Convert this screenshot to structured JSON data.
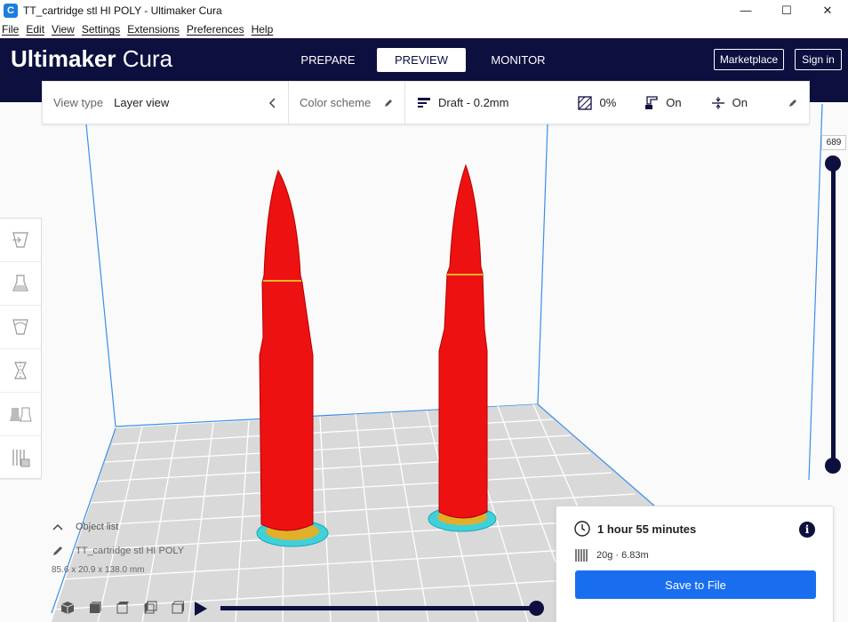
{
  "window": {
    "title": "TT_cartridge stl HI POLY - Ultimaker Cura",
    "app_icon": "C",
    "minimize": "—",
    "maximize": "☐",
    "close": "✕"
  },
  "menu": [
    "File",
    "Edit",
    "View",
    "Settings",
    "Extensions",
    "Preferences",
    "Help"
  ],
  "header": {
    "logo_bold": "Ultimaker",
    "logo_light": "Cura",
    "tabs": [
      {
        "label": "PREPARE",
        "active": false
      },
      {
        "label": "PREVIEW",
        "active": true
      },
      {
        "label": "MONITOR",
        "active": false
      }
    ],
    "marketplace_label": "Marketplace",
    "signin_label": "Sign in",
    "colors": {
      "header_bg": "#0d0f3f",
      "accent": "#196ef0"
    }
  },
  "toolbar": {
    "view_type_label": "View type",
    "view_type_value": "Layer view",
    "color_scheme_label": "Color scheme",
    "profile": "Draft - 0.2mm",
    "infill": "0%",
    "support": "On",
    "adhesion": "On"
  },
  "left_tools": [
    "move-tool-icon",
    "scale-tool-icon",
    "rotate-tool-icon",
    "mirror-tool-icon",
    "per-model-settings-icon",
    "support-blocker-icon"
  ],
  "layer_slider": {
    "current_layer": "689"
  },
  "object_list": {
    "title": "Object list",
    "object_name": "TT_cartridge stl HI POLY",
    "dimensions": "85.6 x 20.9 x 138.0 mm"
  },
  "print_info": {
    "time": "1 hour 55 minutes",
    "material": "20g · 6.83m",
    "save_label": "Save to File",
    "info_glyph": "i"
  },
  "playback": {
    "progress": 1.0
  }
}
